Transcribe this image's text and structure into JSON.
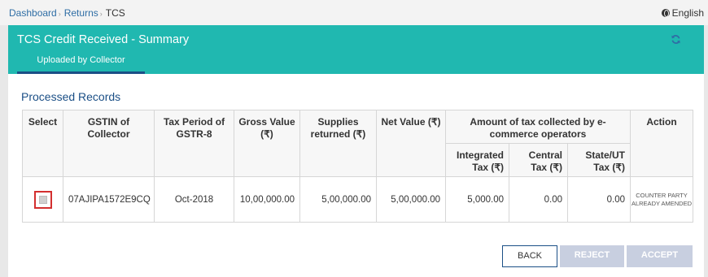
{
  "breadcrumb": {
    "items": [
      "Dashboard",
      "Returns"
    ],
    "current": "TCS"
  },
  "language": {
    "label": "English"
  },
  "header": {
    "title": "TCS Credit Received - Summary",
    "tab_label": "Uploaded by Collector"
  },
  "section": {
    "title": "Processed Records"
  },
  "table": {
    "headers": {
      "select": "Select",
      "gstin": "GSTIN of Collector",
      "tax_period": "Tax Period of GSTR-8",
      "gross_value": "Gross Value (₹)",
      "supplies_returned": "Supplies returned (₹)",
      "net_value": "Net Value (₹)",
      "amount_group": "Amount of tax collected by e-commerce operators",
      "integrated_tax": "Integrated Tax (₹)",
      "central_tax": "Central Tax (₹)",
      "state_ut_tax": "State/UT Tax (₹)",
      "action": "Action"
    },
    "rows": [
      {
        "gstin": "07AJIPA1572E9CQ",
        "tax_period": "Oct-2018",
        "gross_value": "10,00,000.00",
        "supplies_returned": "5,00,000.00",
        "net_value": "5,00,000.00",
        "integrated_tax": "5,000.00",
        "central_tax": "0.00",
        "state_ut_tax": "0.00",
        "action": "COUNTER PARTY ALREADY AMENDED"
      }
    ]
  },
  "buttons": {
    "back": "BACK",
    "reject": "REJECT",
    "accept": "ACCEPT"
  },
  "colors": {
    "header_bg": "#20b8b0",
    "accent_blue": "#1b4f86",
    "link_blue": "#2f6ea5",
    "checkbox_highlight": "#d32f2f",
    "disabled_button": "#c8cfe0"
  }
}
